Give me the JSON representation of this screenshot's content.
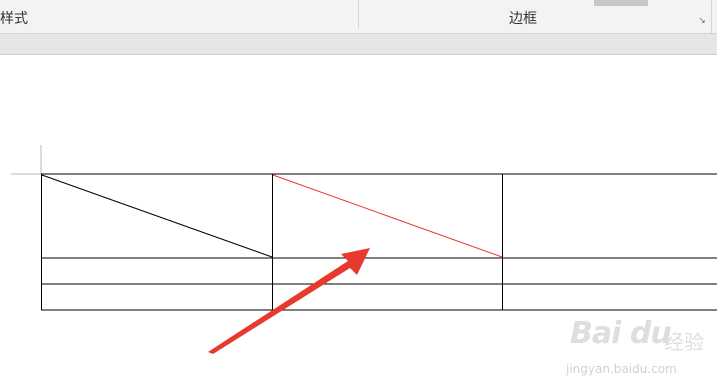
{
  "ribbon": {
    "styles_label": "样式",
    "border_group_label": "边框",
    "dialog_launcher_glyph": "↘"
  },
  "document": {
    "table": {
      "rows": 3,
      "columns": 3,
      "cell_1_1_diagonal": "black",
      "cell_1_2_diagonal": "red"
    },
    "annotation": {
      "arrow_color": "#e8392f",
      "points_to": "red diagonal line in second header cell"
    }
  },
  "watermark": {
    "brand": "Bai du",
    "sub": "经验",
    "url": "jingyan.baidu.com"
  },
  "colors": {
    "ribbon_bg": "#f3f3f3",
    "band_bg": "#e6e6e6",
    "table_border": "#000000",
    "red_diagonal": "#e8392f",
    "arrow": "#e8392f"
  }
}
